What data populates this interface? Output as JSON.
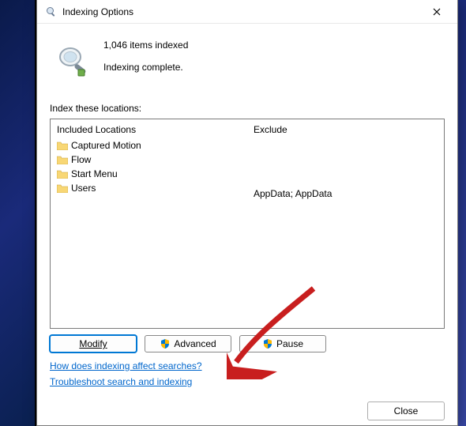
{
  "title": "Indexing Options",
  "status": {
    "count_text": "1,046 items indexed",
    "state_text": "Indexing complete."
  },
  "section_label": "Index these locations:",
  "columns": {
    "included_header": "Included Locations",
    "exclude_header": "Exclude"
  },
  "locations": [
    {
      "name": "Captured Motion",
      "exclude": ""
    },
    {
      "name": "Flow",
      "exclude": ""
    },
    {
      "name": "Start Menu",
      "exclude": ""
    },
    {
      "name": "Users",
      "exclude": "AppData; AppData"
    }
  ],
  "buttons": {
    "modify": "Modify",
    "advanced": "Advanced",
    "pause": "Pause",
    "close": "Close"
  },
  "links": {
    "how": "How does indexing affect searches?",
    "troubleshoot": "Troubleshoot search and indexing"
  }
}
